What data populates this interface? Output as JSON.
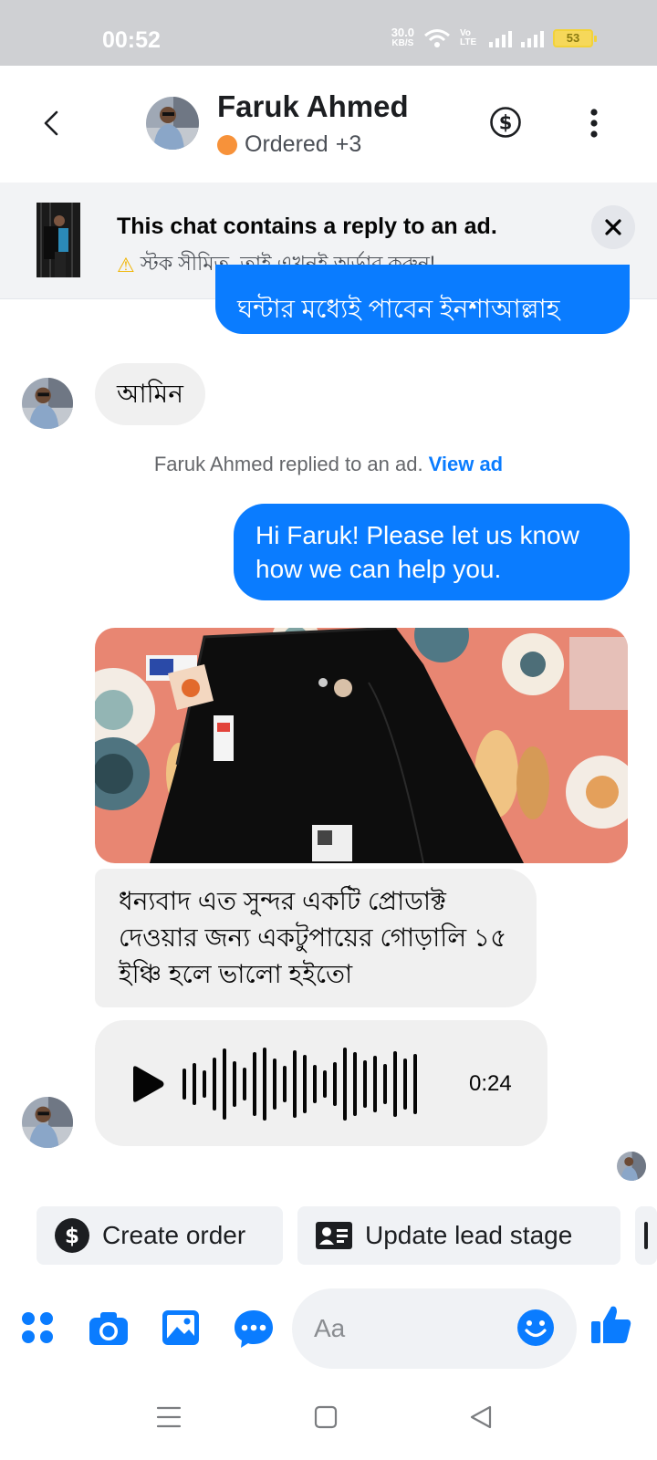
{
  "status_bar": {
    "time": "00:52",
    "net_speed": "30.0",
    "net_unit": "KB/S",
    "volte": "Vo LTE",
    "battery": "53"
  },
  "header": {
    "contact_name": "Faruk Ahmed",
    "status_label": "Ordered",
    "status_extra": "+3",
    "status_color": "#f7923a"
  },
  "ad_banner": {
    "title": "This chat contains a reply to an ad.",
    "subtitle": "স্টক সীমিত, তাই এখনই অর্ডার করুন!"
  },
  "messages": {
    "out_top_partial": "ঘন্টার মধ্যেই পাবেন ইনশাআল্লাহ",
    "in_amin": "আমিন",
    "sys_note": "Faruk Ahmed replied to an ad.",
    "sys_link": "View ad",
    "out_greeting": "Hi Faruk! Please let us know how we can help you.",
    "in_review": "ধন্যবাদ এত সুন্দর একটি প্রোডাক্ট দেওয়ার জন্য একটুপায়ের গোড়ালি ১৫ ইঞ্চি হলে  ভালো হইতো",
    "voice_duration": "0:24"
  },
  "quick_actions": {
    "create_order": "Create order",
    "update_lead_stage": "Update lead stage"
  },
  "composer": {
    "placeholder": "Aa"
  },
  "colors": {
    "accent": "#0a7cff",
    "bubble_in": "#f0f0f0",
    "banner_bg": "#f2f3f5"
  }
}
